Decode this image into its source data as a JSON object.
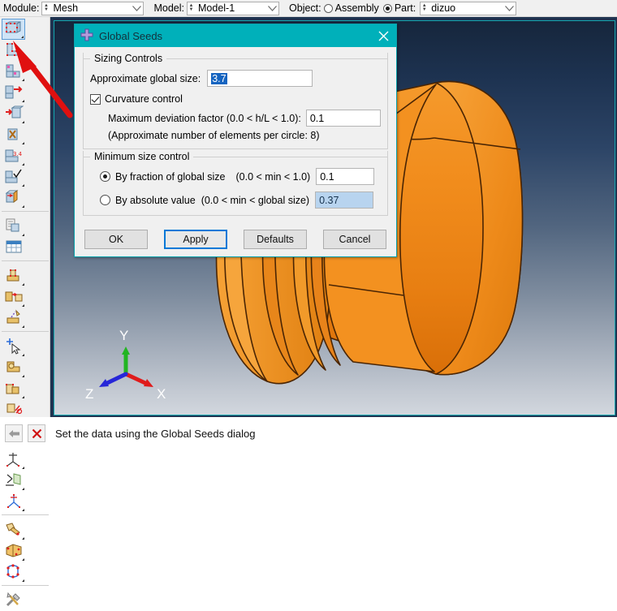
{
  "context_bar": {
    "module_label": "Module:",
    "module_value": "Mesh",
    "model_label": "Model:",
    "model_value": "Model-1",
    "object_label": "Object:",
    "assembly_label": "Assembly",
    "assembly_selected": false,
    "part_label": "Part:",
    "part_selected": true,
    "part_value": "dizuo"
  },
  "toolbox": {
    "items": [
      {
        "name": "seed-part-instance",
        "selected": true
      },
      {
        "name": "seed-edges",
        "selected": false
      },
      {
        "name": "assign-mesh-controls",
        "selected": false
      },
      {
        "name": "assign-element-type",
        "selected": false
      },
      {
        "name": "mesh-part-instance",
        "selected": false
      },
      {
        "name": "delete-part-instance-mesh",
        "selected": false
      },
      {
        "name": "verify-mesh",
        "selected": false
      },
      {
        "name": "mesh-part-stack",
        "selected": false
      },
      {
        "name": "query-information",
        "selected": false
      },
      {
        "name": "mesh-statistics-table",
        "selected": false
      },
      {
        "name": "create-virtual-topology",
        "selected": false
      },
      {
        "name": "merge-edges",
        "selected": false
      },
      {
        "name": "partition-cell",
        "selected": false
      },
      {
        "name": "create-datum-point",
        "selected": false
      },
      {
        "name": "create-datum-axis",
        "selected": false
      },
      {
        "name": "create-datum-plane",
        "selected": false
      },
      {
        "name": "create-datum-csys",
        "selected": false
      },
      {
        "name": "repair-geometry",
        "selected": false
      },
      {
        "name": "edit-mesh",
        "selected": false
      },
      {
        "name": "remesh-region",
        "selected": false
      },
      {
        "name": "mesh-tools",
        "selected": false
      }
    ]
  },
  "dialog": {
    "title": "Global Seeds",
    "icon": "abaqus-seed-icon",
    "close_icon": "close-icon",
    "sizing_group_label": "Sizing Controls",
    "approx_global_size_label": "Approximate global size:",
    "approx_global_size_value": "3.7",
    "approx_global_size_selected": true,
    "curvature_control_label": "Curvature control",
    "curvature_control_checked": true,
    "max_deviation_label": "Maximum deviation factor (0.0 < h/L < 1.0):",
    "max_deviation_value": "0.1",
    "elements_per_circle_note": "(Approximate number of elements per circle: 8)",
    "min_size_group_label": "Minimum size control",
    "by_fraction_label": "By fraction of global size",
    "by_fraction_hint": "(0.0 < min < 1.0)",
    "by_fraction_selected": true,
    "by_fraction_value": "0.1",
    "by_absolute_label": "By absolute value",
    "by_absolute_hint": "(0.0 < min < global size)",
    "by_absolute_selected": false,
    "by_absolute_value": "0.37",
    "by_absolute_disabled": true,
    "buttons": {
      "ok": "OK",
      "apply": "Apply",
      "defaults": "Defaults",
      "cancel": "Cancel",
      "focused": "Apply"
    }
  },
  "viewport": {
    "triad": {
      "x_label": "X",
      "y_label": "Y",
      "z_label": "Z",
      "x_color": "#e01b1b",
      "y_color": "#22b522",
      "z_color": "#2626d8"
    },
    "model": {
      "name": "dizuo-part",
      "color": "#f08a1e",
      "edge_color": "#5a2d05"
    },
    "background_top_color": "#16263c",
    "background_bottom_color": "#d2d7de",
    "border_color": "#15a7b0"
  },
  "annotation": {
    "arrow_color": "#e01010",
    "points_to": "seed-part-instance"
  },
  "status_bar": {
    "back_icon": "back-arrow-icon",
    "cancel_icon": "red-x-icon",
    "message": "Set the data using the Global Seeds dialog"
  }
}
